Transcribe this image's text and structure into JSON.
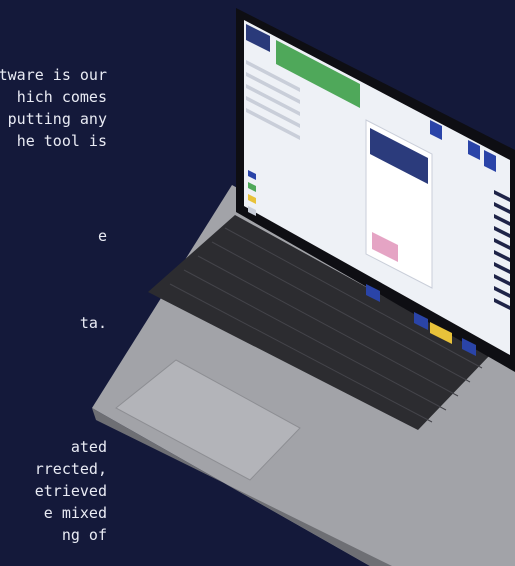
{
  "overlay_text": {
    "block1": [
      "tware is our",
      "hich comes",
      "putting any",
      "he tool is"
    ],
    "block2": [
      "e"
    ],
    "block3": [
      "ta."
    ],
    "block4": [
      "ated",
      "rrected,",
      "etrieved",
      "e mixed",
      "ng of"
    ]
  },
  "colors": {
    "background": "#14193a",
    "laptop_body": "#9a9aa0",
    "keyboard": "#2b2b2e",
    "screen_bezel": "#0c0c10",
    "screen_ui": "#f2f4f8",
    "accent_green": "#4fa85a",
    "accent_blue": "#2a44a8",
    "accent_yellow": "#e8c23a"
  },
  "icons": [
    "laptop-icon",
    "trackpad",
    "keyboard"
  ]
}
